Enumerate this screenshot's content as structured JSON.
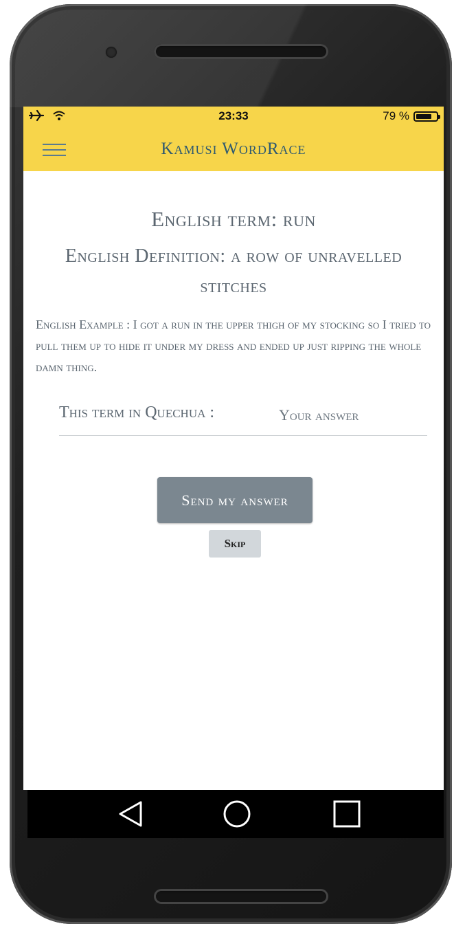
{
  "status_bar": {
    "time": "23:33",
    "battery_percent_text": "79 %",
    "battery_level": 0.79,
    "left_icons": [
      "airplane-icon",
      "wifi-icon"
    ]
  },
  "app_bar": {
    "title": "Kamusi WordRace",
    "menu_icon": "hamburger-menu-icon"
  },
  "quiz": {
    "term": "English term: run",
    "definition": "English Definition: a row of unravelled stitches",
    "example": "English Example : I got a run in the upper thigh of my stocking so I tried to pull them up to hide it under my dress and ended up just ripping the whole damn thing.",
    "answer_label": "This term in Quechua :",
    "answer_placeholder": "Your answer",
    "answer_value": "",
    "send_button": "Send my answer",
    "skip_button": "Skip"
  },
  "nav_bar": {
    "buttons": [
      "back-icon",
      "home-icon",
      "recents-icon"
    ]
  },
  "colors": {
    "accent": "#f7d54a",
    "title_text": "#2f5a70",
    "body_text": "#5b6670",
    "send_button": "#7b8790",
    "skip_button": "#d2d7db"
  }
}
